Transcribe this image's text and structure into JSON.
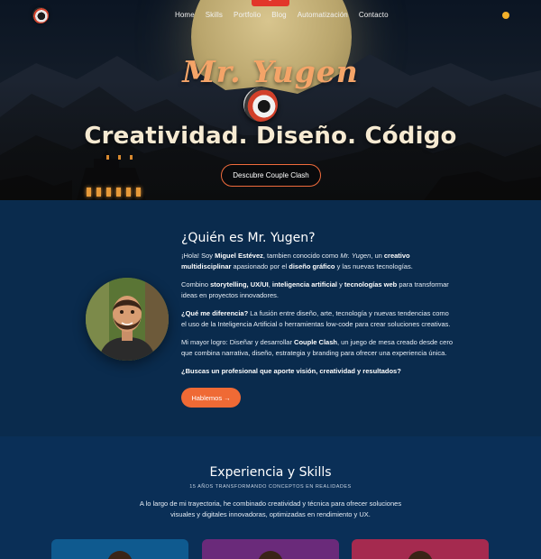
{
  "nav": {
    "links": [
      "Home",
      "Skills",
      "Portfolio",
      "Blog",
      "Automatización",
      "Contacto"
    ]
  },
  "hero": {
    "script_title": "Mr. Yugen",
    "headline": "Creatividad. Diseño. Código",
    "cta": "Descubre Couple Clash"
  },
  "about": {
    "title": "¿Quién es Mr. Yugen?",
    "p1_a": "¡Hola! Soy ",
    "p1_name": "Miguel Estévez",
    "p1_b": ", tambien conocido como ",
    "p1_alias": "Mr. Yugen",
    "p1_c": ", un ",
    "p1_d": "creativo multidisciplinar",
    "p1_e": " apasionado por el ",
    "p1_f": "diseño gráfico",
    "p1_g": " y las nuevas tecnologías.",
    "p2_a": "Combino ",
    "p2_b": "storytelling, UX/UI",
    "p2_c": ", ",
    "p2_d": "inteligencia artificial",
    "p2_e": " y ",
    "p2_f": "tecnologías web",
    "p2_g": " para transformar ideas en proyectos innovadores.",
    "p3_a": "¿Qué me diferencia?",
    "p3_b": " La fusión entre diseño, arte, tecnología y nuevas tendencias como el uso de la Inteligencia Artificial o herramientas low-code para crear soluciones creativas.",
    "p4_a": "Mi mayor logro: Diseñar y desarrollar ",
    "p4_b": "Couple Clash",
    "p4_c": ", un juego de mesa creado desde cero que combina narrativa, diseño, estrategia y branding para ofrecer una experiencia única.",
    "p5": "¿Buscas un profesional que aporte visión, creatividad y resultados?",
    "cta": "Hablemos →"
  },
  "skills": {
    "title": "Experiencia y Skills",
    "subtitle": "15 AÑOS TRANSFORMANDO CONCEPTOS EN REALIDADES",
    "description": "A lo largo de mi trayectoria, he combinado creatividad y técnica para ofrecer soluciones visuales y digitales innovadoras, optimizadas en rendimiento y UX."
  }
}
